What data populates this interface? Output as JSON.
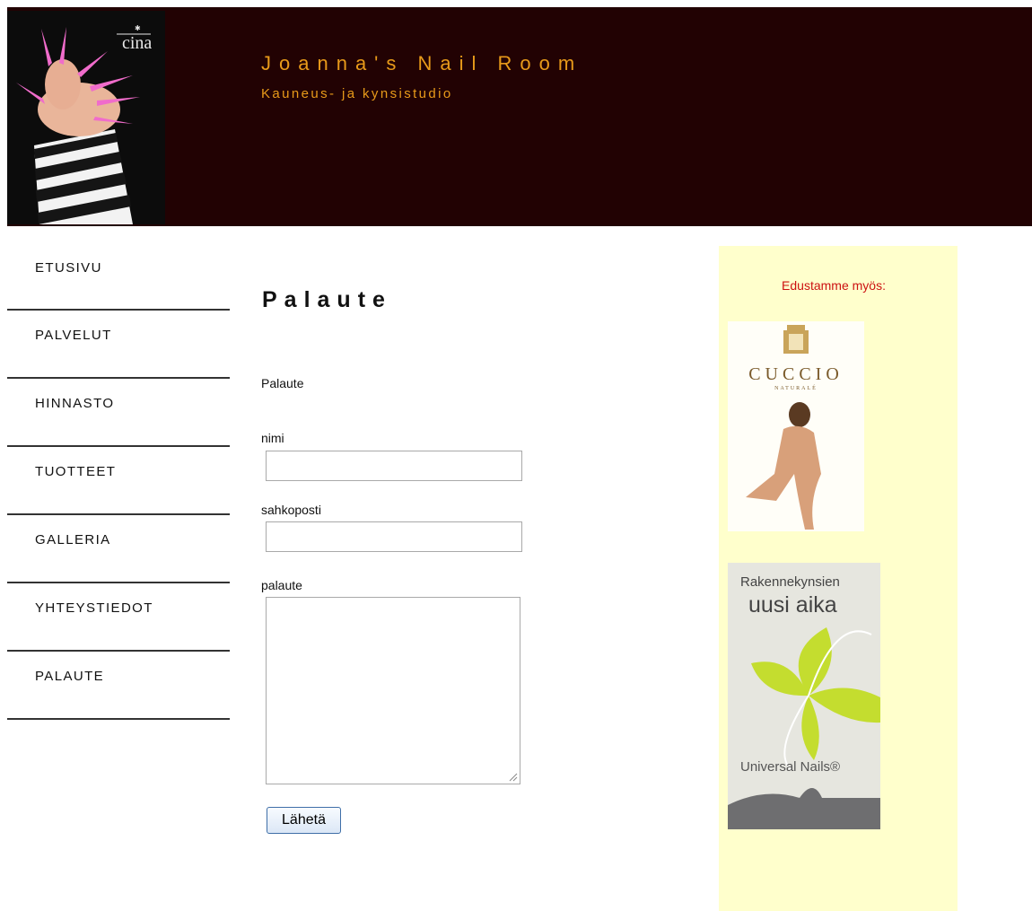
{
  "header": {
    "title": "Joanna's Nail Room",
    "subtitle": "Kauneus- ja kynsistudio",
    "logo_text": "cina"
  },
  "nav": {
    "items": [
      {
        "label": "ETUSIVU"
      },
      {
        "label": "PALVELUT"
      },
      {
        "label": "HINNASTO"
      },
      {
        "label": "TUOTTEET"
      },
      {
        "label": "GALLERIA"
      },
      {
        "label": "YHTEYSTIEDOT"
      },
      {
        "label": "PALAUTE"
      }
    ]
  },
  "main": {
    "title": "Palaute",
    "form_label": "Palaute",
    "name_label": "nimi",
    "name_value": "",
    "email_label": "sahkoposti",
    "email_value": "",
    "feedback_label": "palaute",
    "feedback_value": "",
    "submit_label": "Lähetä"
  },
  "sidebar": {
    "title": "Edustamme myös:",
    "cuccio": {
      "brand": "CUCCIO",
      "sub": "NATURALÉ"
    },
    "universal": {
      "line1": "Rakennekynsien",
      "line2": "uusi aika",
      "brand": "Universal Nails®"
    }
  },
  "colors": {
    "header_bg": "#220203",
    "header_text": "#e89a1a",
    "sidebar_bg": "#ffffcc",
    "sidebar_title": "#cc1111"
  }
}
